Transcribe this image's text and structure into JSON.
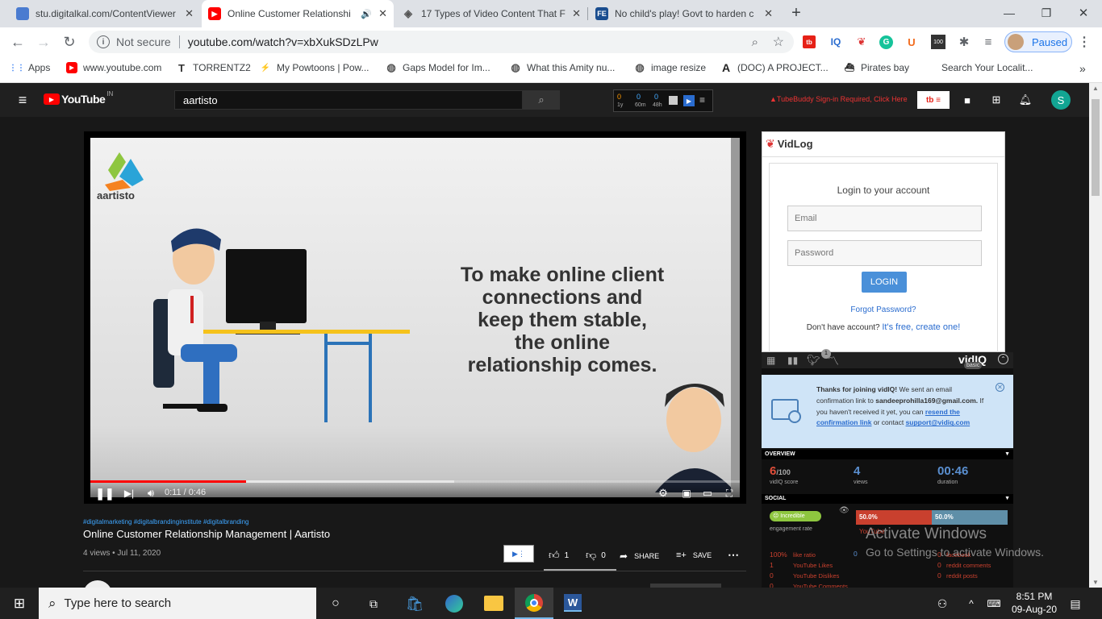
{
  "tabs": [
    {
      "title": "stu.digitalkal.com/ContentViewer",
      "close": "✕",
      "icon_color": "#4a7bd0"
    },
    {
      "title": "Online Customer Relationshi",
      "close": "✕",
      "icon_color": "#ff0000"
    },
    {
      "title": "17 Types of Video Content That F",
      "close": "✕",
      "icon_color": "#555"
    },
    {
      "title": "No child's play! Govt to harden c",
      "close": "✕",
      "icon_color": "#1a4d8f",
      "icon_text": "FE"
    }
  ],
  "new_tab": "+",
  "window": {
    "minimize": "—",
    "restore": "❐",
    "close": "✕"
  },
  "toolbar": {
    "not_secure": "Not secure",
    "url": "youtube.com/watch?v=xbXukSDzLPw",
    "paused": "Paused"
  },
  "bookmarks": [
    "Apps",
    "www.youtube.com",
    "TORRENTZ2",
    "My Powtoons | Pow...",
    "Gaps Model for Im...",
    "What this Amity nu...",
    "image resize",
    "(DOC) A PROJECT...",
    "Pirates bay",
    "Search Your Localit..."
  ],
  "youtube": {
    "logo": "YouTube",
    "country": "IN",
    "search_value": "aartisto",
    "counter": {
      "n1": "0",
      "n2": "0",
      "n3": "0",
      "l1": "1y",
      "l2": "60m",
      "l3": "48h"
    },
    "tubebuddy": "TubeBuddy Sign-in Required, Click Here",
    "avatar": "S"
  },
  "video": {
    "brand": "aartisto",
    "caption_lines": [
      "To make online client",
      "connections and",
      "keep them stable,",
      "the online",
      "relationship comes."
    ],
    "time": "0:11 / 0:46",
    "progress": 0.24,
    "buffered": 0.56,
    "hashtags": "#digitalmarketing #digitalbrandinginstitute #digitalbranding",
    "title": "Online Customer Relationship Management | Aartisto",
    "meta": "4 views • Jul 11, 2020",
    "likes": "1",
    "dislikes": "0",
    "share": "SHARE",
    "save": "SAVE"
  },
  "vidlog": {
    "brand": "VidLog",
    "heading": "Login to your account",
    "email_ph": "Email",
    "password_ph": "Password",
    "login": "LOGIN",
    "forgot": "Forgot Password?",
    "no_account": "Don't have account?",
    "free": "It's free, create one!"
  },
  "vidiq": {
    "logo": "vidIQ",
    "badge": "basic",
    "notif_count": "1",
    "notice_bold": "Thanks for joining vidIQ!",
    "notice_1": "We sent an email confirmation link to",
    "notice_email": "sandeeprohilla169@gmail.com.",
    "notice_2": "If you haven't received it yet, you can",
    "notice_link1": "resend the confirmation link",
    "notice_3": "or contact",
    "notice_link2": "support@vidiq.com",
    "overview": "OVERVIEW",
    "score": "6",
    "score_den": "/100",
    "score_label": "vidIQ score",
    "views": "4",
    "views_label": "views",
    "duration": "00:46",
    "duration_label": "duration",
    "social": "SOCIAL",
    "incredible": "Incredible",
    "engagement": "engagement rate",
    "pct1": "50.0%",
    "pct2": "50.0%",
    "yt_label": "YouTube",
    "rows": [
      {
        "v": "100%",
        "l": "like ratio"
      },
      {
        "v": "1",
        "l": "YouTube Likes"
      },
      {
        "v": "0",
        "l": "YouTube Dislikes"
      },
      {
        "v": "0",
        "l": "YouTube Comments"
      }
    ],
    "right_rows": [
      {
        "v": "0",
        "l": "facebook"
      },
      {
        "v": "0",
        "l": "reddit comments"
      },
      {
        "v": "0",
        "l": "reddit posts"
      }
    ],
    "mid_val": "0"
  },
  "activate": {
    "line1": "Activate Windows",
    "line2": "Go to Settings to activate Windows."
  },
  "taskbar": {
    "search": "Type here to search",
    "time": "8:51 PM",
    "date": "09-Aug-20"
  }
}
